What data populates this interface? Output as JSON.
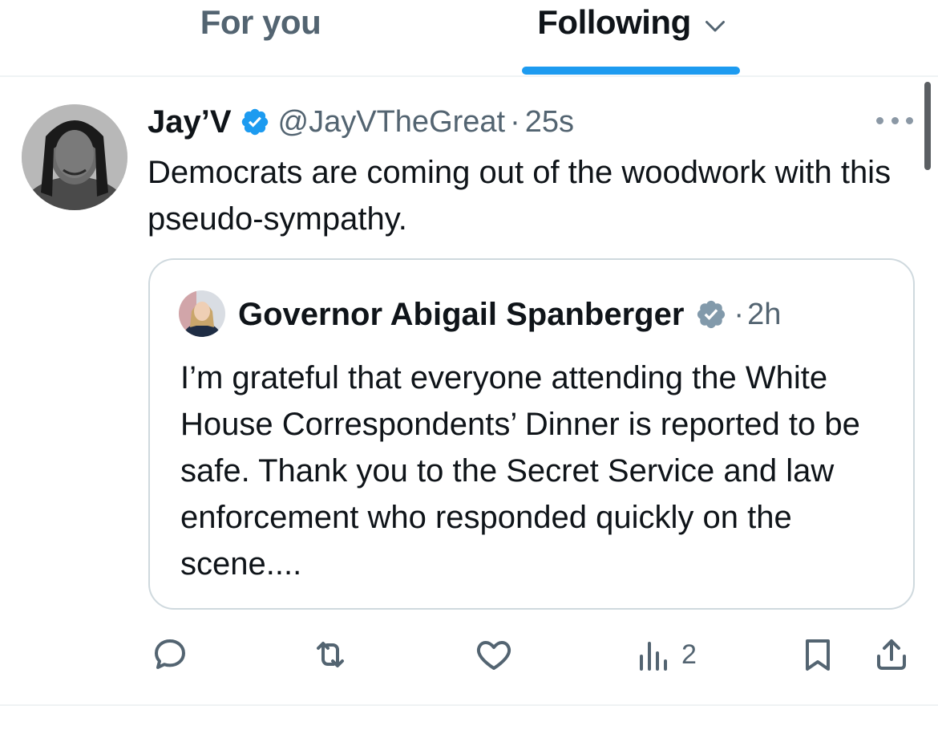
{
  "tabs": [
    {
      "label": "For you",
      "active": false
    },
    {
      "label": "Following",
      "active": true,
      "icon": "chevron-down-icon"
    }
  ],
  "colors": {
    "accent": "#1d9bf0",
    "secondary_text": "#536471",
    "primary_text": "#0f1419",
    "border": "#cfd9de"
  },
  "post": {
    "author_name": "Jay’V",
    "verified": true,
    "handle": "@JayVTheGreat",
    "separator": "·",
    "time": "25s",
    "text": "Democrats are coming out of the woodwork with this pseudo-sympathy.",
    "more_icon": "more-icon"
  },
  "quote": {
    "author_name": "Governor Abigail Spanberger",
    "verified": true,
    "verified_type": "government-gray",
    "separator": "·",
    "time": "2h",
    "text": "I’m grateful that everyone attending the White House Correspondents’ Dinner is reported to be safe. Thank you to the Secret Service and law enforcement who responded quickly on the scene...."
  },
  "actions": {
    "reply": {
      "icon": "reply-icon"
    },
    "repost": {
      "icon": "repost-icon"
    },
    "like": {
      "icon": "heart-icon"
    },
    "views": {
      "icon": "views-icon",
      "count": "2"
    },
    "bookmark": {
      "icon": "bookmark-icon"
    },
    "share": {
      "icon": "share-icon"
    }
  }
}
